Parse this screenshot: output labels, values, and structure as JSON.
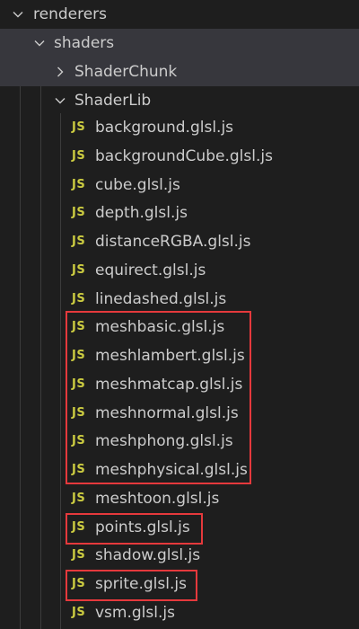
{
  "theme": {
    "background": "#1e1e1e",
    "selected_row": "#37373d",
    "text": "#cccccc",
    "js_icon_color": "#cbcb41",
    "highlight_border": "#e5393c"
  },
  "tree": {
    "folders": {
      "renderers": {
        "label": "renderers",
        "icon": "chevron-down-icon"
      },
      "shaders": {
        "label": "shaders",
        "icon": "chevron-down-icon"
      },
      "shaderchunk": {
        "label": "ShaderChunk",
        "icon": "chevron-right-icon"
      },
      "shaderlib": {
        "label": "ShaderLib",
        "icon": "chevron-down-icon"
      }
    },
    "file_icon_text": "JS",
    "files": [
      {
        "name": "background.glsl.js"
      },
      {
        "name": "backgroundCube.glsl.js"
      },
      {
        "name": "cube.glsl.js"
      },
      {
        "name": "depth.glsl.js"
      },
      {
        "name": "distanceRGBA.glsl.js"
      },
      {
        "name": "equirect.glsl.js"
      },
      {
        "name": "linedashed.glsl.js"
      },
      {
        "name": "meshbasic.glsl.js"
      },
      {
        "name": "meshlambert.glsl.js"
      },
      {
        "name": "meshmatcap.glsl.js"
      },
      {
        "name": "meshnormal.glsl.js"
      },
      {
        "name": "meshphong.glsl.js"
      },
      {
        "name": "meshphysical.glsl.js"
      },
      {
        "name": "meshtoon.glsl.js"
      },
      {
        "name": "points.glsl.js"
      },
      {
        "name": "shadow.glsl.js"
      },
      {
        "name": "sprite.glsl.js"
      },
      {
        "name": "vsm.glsl.js"
      }
    ]
  }
}
